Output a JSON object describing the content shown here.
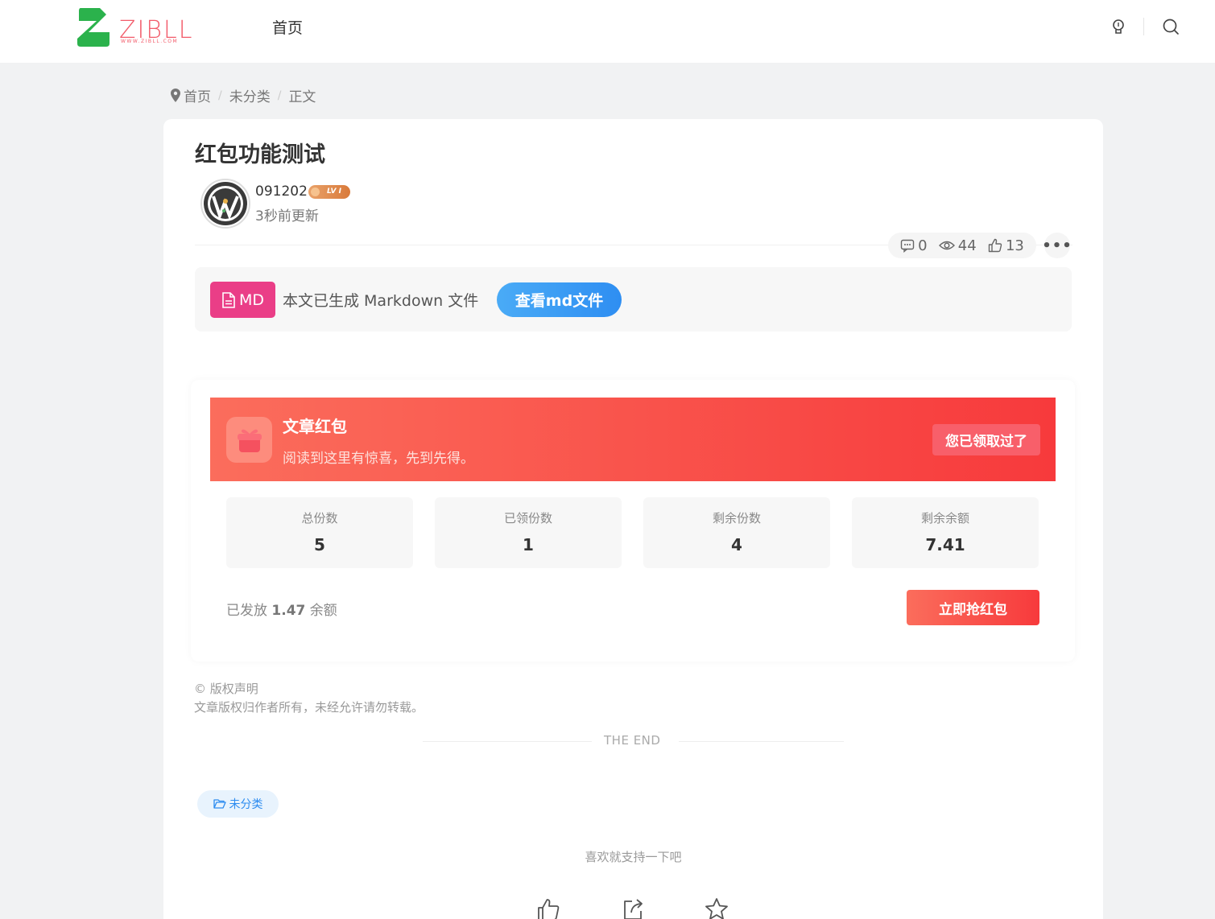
{
  "header": {
    "logo_text": "ZIBLL",
    "logo_sub": "WWW.ZIBLL.COM",
    "nav": {
      "home": "首页"
    }
  },
  "breadcrumb": [
    "首页",
    "未分类",
    "正文"
  ],
  "post": {
    "title": "红包功能测试",
    "author": "091202",
    "level": "LV I",
    "time": "3秒前更新",
    "stats": {
      "comments": "0",
      "views": "44",
      "likes": "13"
    }
  },
  "md": {
    "tag": "MD",
    "text": "本文已生成 Markdown 文件",
    "button": "查看md文件"
  },
  "redpacket": {
    "title": "文章红包",
    "subtitle": "阅读到这里有惊喜，先到先得。",
    "claimed": "您已领取过了",
    "stats": [
      {
        "label": "总份数",
        "value": "5"
      },
      {
        "label": "已领份数",
        "value": "1"
      },
      {
        "label": "剩余份数",
        "value": "4"
      },
      {
        "label": "剩余余额",
        "value": "7.41"
      }
    ],
    "issued_prefix": "已发放",
    "issued_amount": "1.47",
    "issued_suffix": "余额",
    "grab": "立即抢红包"
  },
  "copyright": {
    "title": "© 版权声明",
    "text": "文章版权归作者所有，未经允许请勿转载。"
  },
  "the_end": "THE END",
  "category_tag": "未分类",
  "support_text": "喜欢就支持一下吧",
  "colors": {
    "accent_red": "#f73a3c",
    "accent_blue": "#2e8ef2",
    "md_pink": "#ea3e87",
    "logo_green": "#2bb24c"
  }
}
